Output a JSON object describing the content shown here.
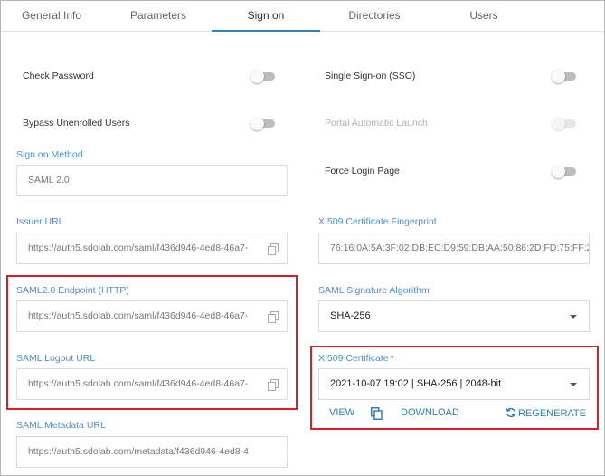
{
  "tabs": [
    {
      "label": "General Info"
    },
    {
      "label": "Parameters"
    },
    {
      "label": "Sign on"
    },
    {
      "label": "Directories"
    },
    {
      "label": "Users"
    }
  ],
  "toggles": {
    "check_password": {
      "label": "Check Password",
      "on": false
    },
    "single_sign_on": {
      "label": "Single Sign-on (SSO)",
      "on": false
    },
    "bypass_unenrolled": {
      "label": "Bypass Unenrolled Users",
      "on": false
    },
    "portal_auto_launch": {
      "label": "Portal Automatic Launch",
      "on": false,
      "disabled": true
    },
    "force_login_page": {
      "label": "Force Login Page",
      "on": false
    }
  },
  "fields": {
    "sign_on_method": {
      "label": "Sign on Method",
      "value": "SAML 2.0"
    },
    "issuer_url": {
      "label": "Issuer URL",
      "value": "https://auth5.sdolab.com/saml/f436d946-4ed8-46a7-"
    },
    "x509_fingerprint": {
      "label": "X.509 Certificate Fingerprint",
      "value": "76:16:0A:5A:3F:02:DB:EC:D9:59:DB:AA:50:86:2D:FD:75:FF:2"
    },
    "saml_endpoint": {
      "label": "SAML2.0 Endpoint (HTTP)",
      "value": "https://auth5.sdolab.com/saml/f436d946-4ed8-46a7-"
    },
    "saml_signature_algorithm": {
      "label": "SAML Signature Algorithm",
      "value": "SHA-256"
    },
    "saml_logout_url": {
      "label": "SAML Logout URL",
      "value": "https://auth5.sdolab.com/saml/f436d946-4ed8-46a7-"
    },
    "x509_certificate": {
      "label": "X.509 Certificate",
      "required_mark": "*",
      "value": "2021-10-07 19:02 | SHA-256 | 2048-bit"
    },
    "saml_metadata_url": {
      "label": "SAML Metadata URL",
      "value": "https://auth5.sdolab.com/metadata/f436d946-4ed8-4"
    }
  },
  "cert_actions": {
    "view": "VIEW",
    "download": "DOWNLOAD",
    "regenerate": "REGENERATE"
  },
  "icons": {
    "copy": "copy-icon",
    "duplicate": "duplicate-icon",
    "regenerate": "refresh-icon",
    "caret": "caret-down-icon"
  },
  "colors": {
    "accent": "#2f7fc1",
    "label_blue": "#4a90d9",
    "highlight_red": "#d61f26",
    "required": "#d9302c"
  }
}
